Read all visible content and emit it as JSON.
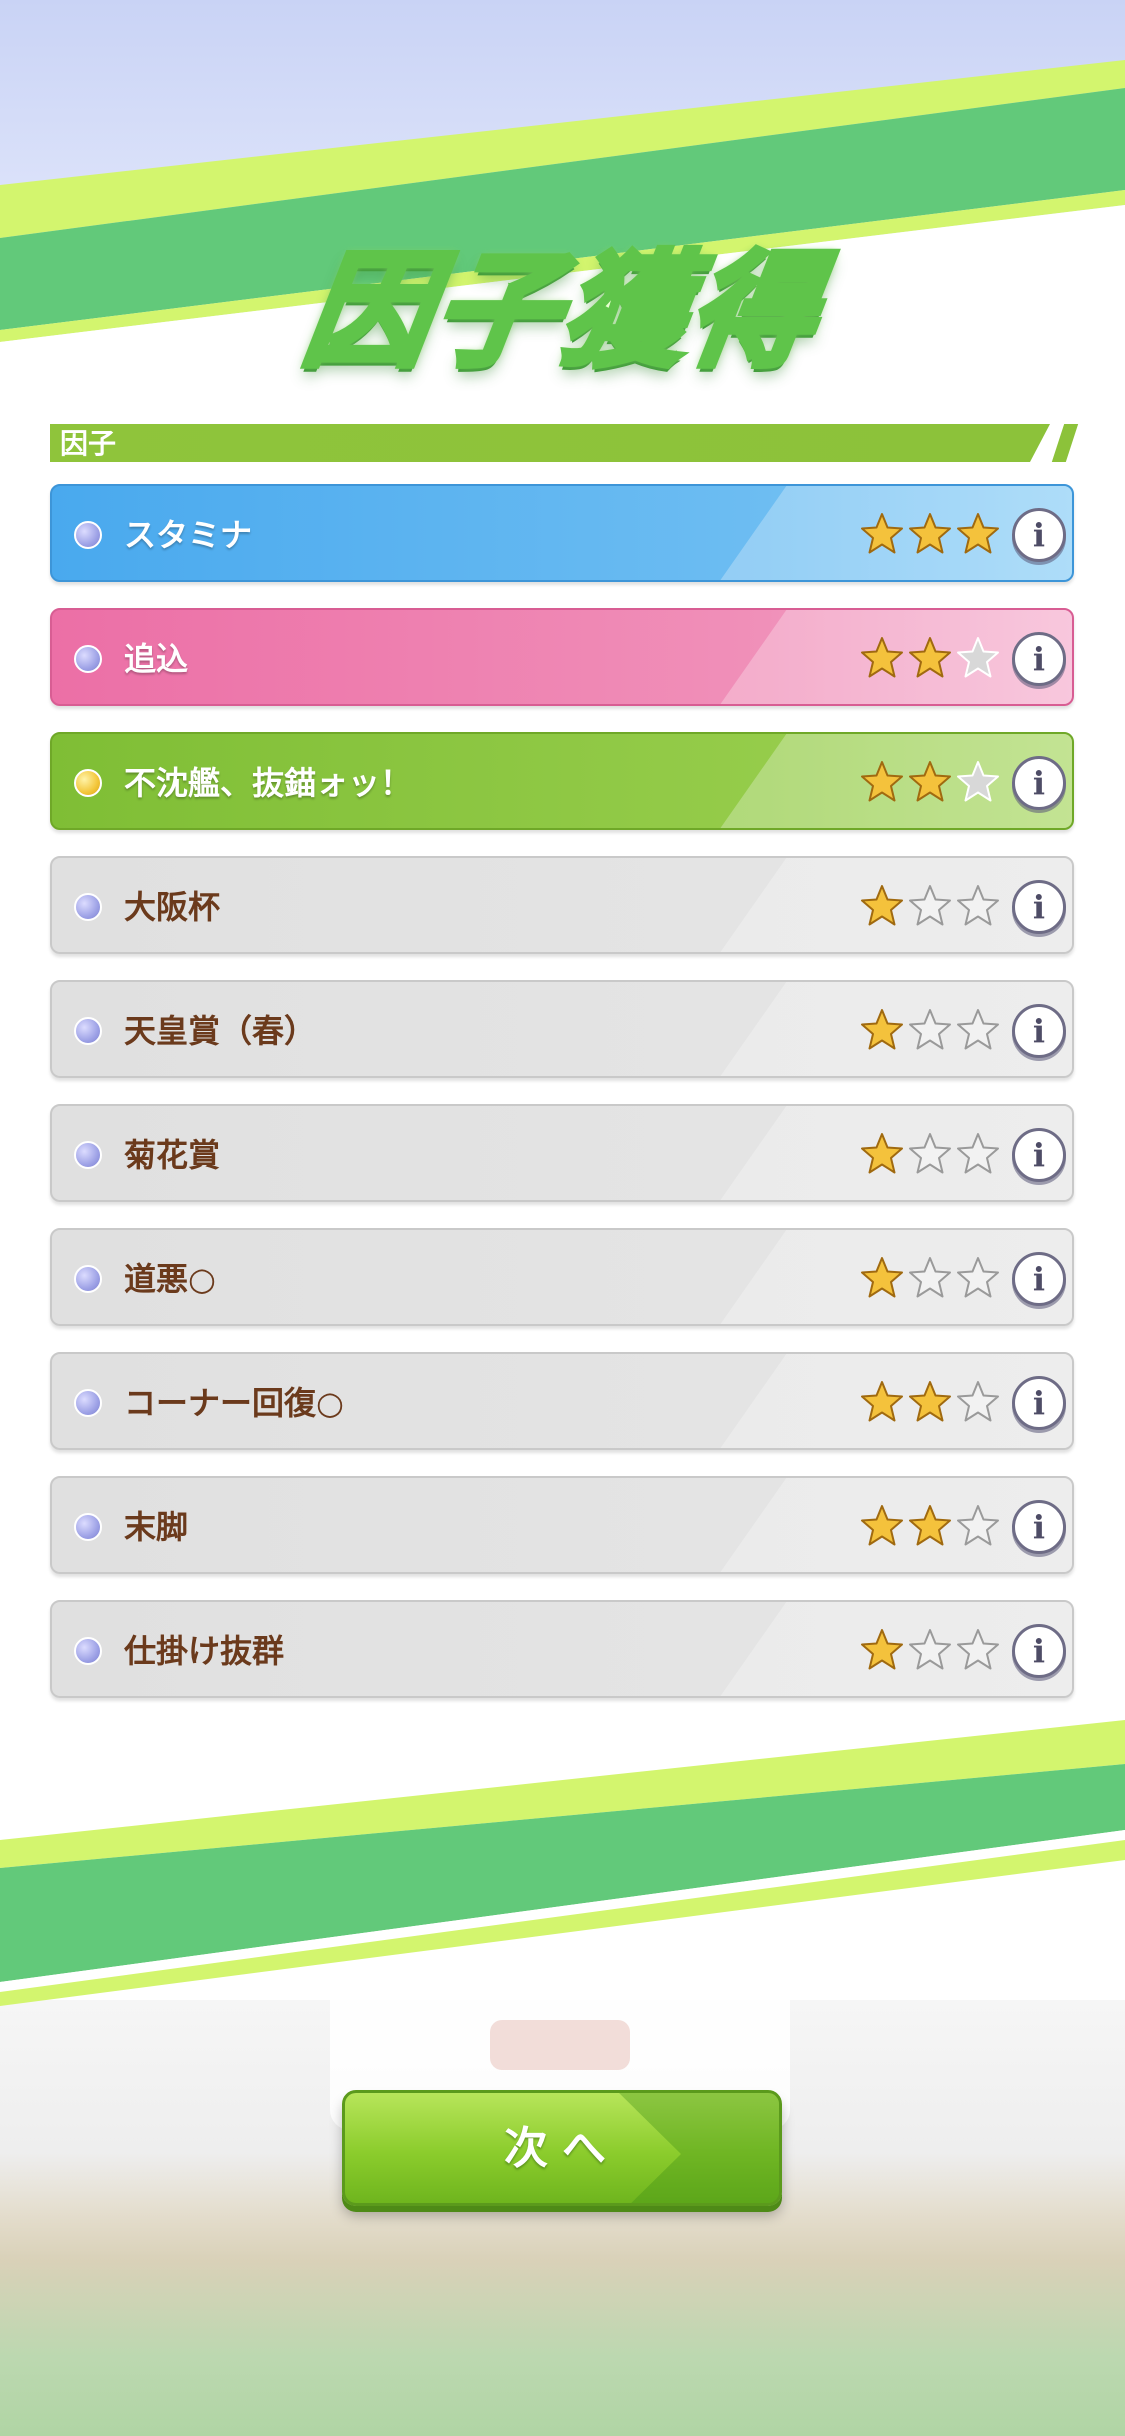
{
  "screen": {
    "title": "因子獲得",
    "section_label": "因子"
  },
  "factors": [
    {
      "name": "スタミナ",
      "stars": 3,
      "color": "blue",
      "orb": "blue",
      "text_color": "#ffffff"
    },
    {
      "name": "追込",
      "stars": 2,
      "color": "pink",
      "orb": "blue",
      "text_color": "#ffffff"
    },
    {
      "name": "不沈艦、抜錨ォッ！",
      "stars": 2,
      "color": "green",
      "orb": "gold",
      "text_color": "#ffffff"
    },
    {
      "name": "大阪杯",
      "stars": 1,
      "color": "gray",
      "orb": "blue",
      "text_color": "#6b3a1c"
    },
    {
      "name": "天皇賞（春）",
      "stars": 1,
      "color": "gray",
      "orb": "blue",
      "text_color": "#6b3a1c"
    },
    {
      "name": "菊花賞",
      "stars": 1,
      "color": "gray",
      "orb": "blue",
      "text_color": "#6b3a1c"
    },
    {
      "name": "道悪○",
      "stars": 1,
      "color": "gray",
      "orb": "blue",
      "text_color": "#6b3a1c"
    },
    {
      "name": "コーナー回復○",
      "stars": 2,
      "color": "gray",
      "orb": "blue",
      "text_color": "#6b3a1c"
    },
    {
      "name": "末脚",
      "stars": 2,
      "color": "gray",
      "orb": "blue",
      "text_color": "#6b3a1c"
    },
    {
      "name": "仕掛け抜群",
      "stars": 1,
      "color": "gray",
      "orb": "blue",
      "text_color": "#6b3a1c"
    }
  ],
  "max_stars": 3,
  "info_glyph": "i",
  "next_button": {
    "label": "次へ"
  },
  "colors": {
    "blue": "#5fb4ee",
    "pink": "#ee7fae",
    "green": "#8cc63f",
    "gray": "#e3e3e3",
    "accent_green": "#8cc23a",
    "star_filled": "#f4c23c"
  },
  "icons": {
    "info": "info-icon",
    "star": "star-icon",
    "orb": "orb-icon"
  }
}
